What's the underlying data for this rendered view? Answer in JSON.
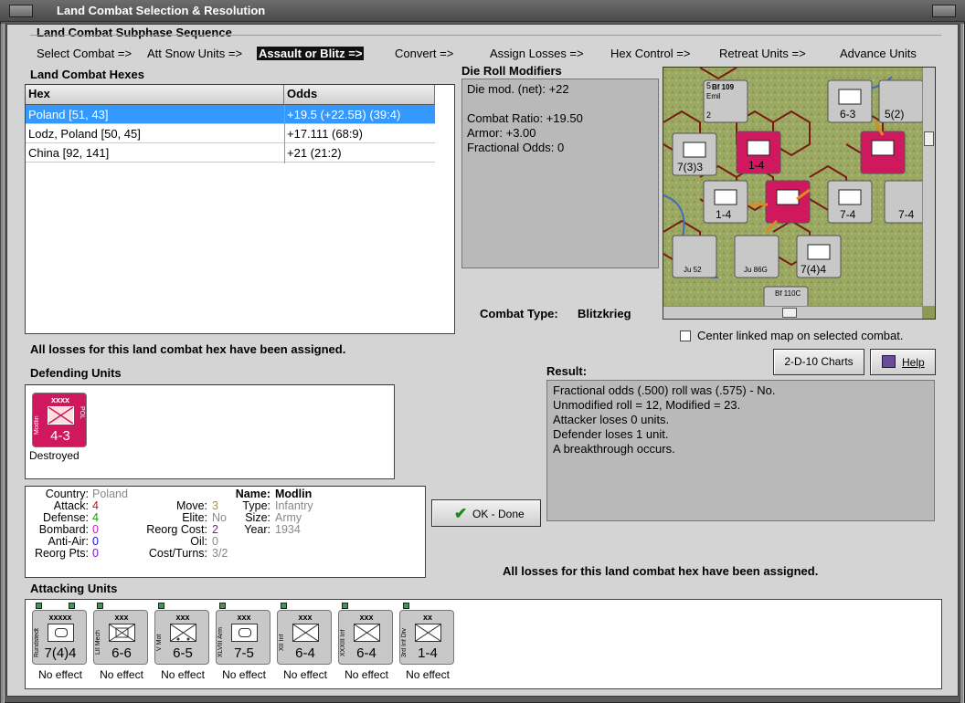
{
  "window": {
    "title": "Land Combat Selection & Resolution"
  },
  "subphase": {
    "heading": "Land Combat Subphase Sequence",
    "steps": [
      {
        "label": "Select Combat =>"
      },
      {
        "label": "Att Snow Units =>"
      },
      {
        "label": "Assault or Blitz =>"
      },
      {
        "label": "Convert =>"
      },
      {
        "label": "Assign Losses =>"
      },
      {
        "label": "Hex Control =>"
      },
      {
        "label": "Retreat Units =>"
      },
      {
        "label": "Advance Units"
      }
    ],
    "current_index": 2
  },
  "hexes": {
    "heading": "Land Combat Hexes",
    "col_hex": "Hex",
    "col_odds": "Odds",
    "rows": [
      {
        "hex": "Poland [51, 43]",
        "odds": "+19.5 (+22.5B) (39:4)"
      },
      {
        "hex": "Lodz, Poland [50, 45]",
        "odds": "+17.111 (68:9)"
      },
      {
        "hex": "China [92, 141]",
        "odds": "+21 (21:2)"
      }
    ],
    "selected_index": 0
  },
  "modifiers": {
    "heading": "Die Roll Modifiers",
    "lines": [
      "Die mod. (net): +22",
      "",
      "Combat Ratio: +19.50",
      "Armor: +3.00",
      "Fractional Odds: 0"
    ]
  },
  "combat_type": {
    "label": "Combat Type:",
    "value": "Blitzkrieg"
  },
  "center_map": {
    "label": "Center linked map on selected combat.",
    "checked": false
  },
  "losses_msg_left": "All losses for this land combat hex have been assigned.",
  "losses_msg_right": "All losses for this land combat hex have been assigned.",
  "buttons": {
    "charts": "2-D-10 Charts",
    "help": "Help",
    "ok": "OK - Done"
  },
  "result": {
    "heading": "Result:",
    "lines": [
      "Fractional odds (.500) roll was (.575)  - No.",
      "Unmodified roll = 12, Modified = 23.",
      "Attacker loses 0 units.",
      "Defender loses 1 unit.",
      "A breakthrough occurs."
    ]
  },
  "defending": {
    "heading": "Defending Units",
    "unit": {
      "size": "xxxx",
      "name": "Modlin",
      "side": "POL",
      "factors": "4-3",
      "status": "Destroyed",
      "color": "#d0185e"
    }
  },
  "unit_info": {
    "country_lbl": "Country:",
    "country": "Poland",
    "attack_lbl": "Attack:",
    "attack": "4",
    "defense_lbl": "Defense:",
    "defense": "4",
    "bombard_lbl": "Bombard:",
    "bombard": "0",
    "antiair_lbl": "Anti-Air:",
    "antiair": "0",
    "reorgpts_lbl": "Reorg Pts:",
    "reorgpts": "0",
    "move_lbl": "Move:",
    "move": "3",
    "elite_lbl": "Elite:",
    "elite": "No",
    "reorgcost_lbl": "Reorg Cost:",
    "reorgcost": "2",
    "oil_lbl": "Oil:",
    "oil": "0",
    "costturns_lbl": "Cost/Turns:",
    "costturns": "3/2",
    "name_lbl": "Name:",
    "name": "Modlin",
    "type_lbl": "Type:",
    "type": "Infantry",
    "size_lbl": "Size:",
    "size": "Army",
    "year_lbl": "Year:",
    "year": "1934"
  },
  "attacking": {
    "heading": "Attacking Units",
    "units": [
      {
        "size": "xxxxx",
        "name": "Rundstedt",
        "factors": "7(4)4",
        "status": "No effect",
        "kind": "hq"
      },
      {
        "size": "xxx",
        "name": "LII Mech",
        "factors": "6-6",
        "status": "No effect",
        "kind": "inf"
      },
      {
        "size": "xxx",
        "name": "V Mot",
        "factors": "6-5",
        "status": "No effect",
        "kind": "mot"
      },
      {
        "size": "xxx",
        "name": "XLVIII Arm",
        "factors": "7-5",
        "status": "No effect",
        "kind": "arm"
      },
      {
        "size": "xxx",
        "name": "XII Inf",
        "factors": "6-4",
        "status": "No effect",
        "kind": "inf"
      },
      {
        "size": "xxx",
        "name": "XXXIII Inf",
        "factors": "6-4",
        "status": "No effect",
        "kind": "inf"
      },
      {
        "size": "xx",
        "name": "3rd Inf Div",
        "factors": "1-4",
        "status": "No effect",
        "kind": "inf"
      }
    ]
  },
  "map": {
    "counters": [
      {
        "label": "Bf 109",
        "sub": "Emil",
        "top": "5",
        "corner": "2"
      },
      {
        "label": "7(3)3"
      },
      {
        "label": "1-4"
      },
      {
        "label": "6-3"
      },
      {
        "label": "5(2)"
      },
      {
        "label": "1-4"
      },
      {
        "label": "7-4"
      },
      {
        "label": "7-4"
      },
      {
        "label": "7(4)4"
      },
      {
        "label": "Ju 52"
      },
      {
        "label": "Ju 86G"
      },
      {
        "label": "Bf 110C"
      }
    ]
  }
}
